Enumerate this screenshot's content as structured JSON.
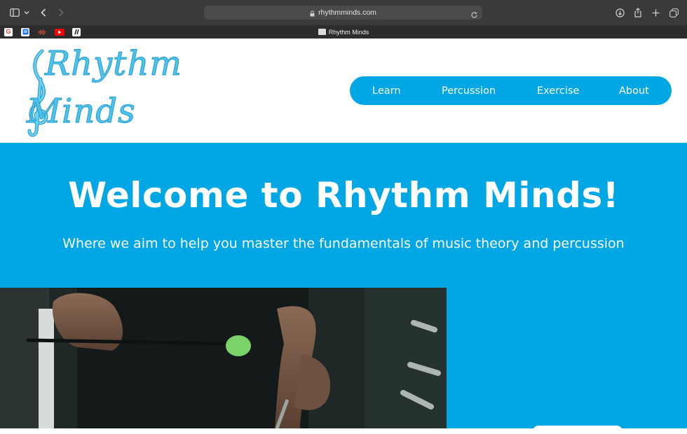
{
  "browser": {
    "url": "rhythmminds.com",
    "tab_title": "Rhythm Minds",
    "favorites": [
      {
        "icon": "google-icon",
        "glyph": "G",
        "bg": "#ffffff",
        "fg": "#ea4335"
      },
      {
        "icon": "docs-icon",
        "glyph": "",
        "bg": "#ffffff",
        "fg": "#1a73e8"
      },
      {
        "icon": "soundwave-icon",
        "glyph": "",
        "bg": "#2c2c2e",
        "fg": "#e2513a"
      },
      {
        "icon": "youtube-icon",
        "glyph": "",
        "bg": "#ff0000",
        "fg": "#ffffff"
      },
      {
        "icon": "bookmark-app-icon",
        "glyph": "",
        "bg": "#ffffff",
        "fg": "#111111"
      }
    ]
  },
  "logo": {
    "line1": "Rhythm",
    "line2": "Minds"
  },
  "nav": {
    "items": [
      "Learn",
      "Percussion",
      "Exercise",
      "About"
    ]
  },
  "hero": {
    "title": "Welcome to Rhythm Minds!",
    "subtitle": "Where we aim to help you master the fundamentals of music theory and percussion"
  },
  "colors": {
    "accent": "#00a7e4",
    "logo": "#4dc2ea",
    "chrome": "#3a3a3c"
  }
}
